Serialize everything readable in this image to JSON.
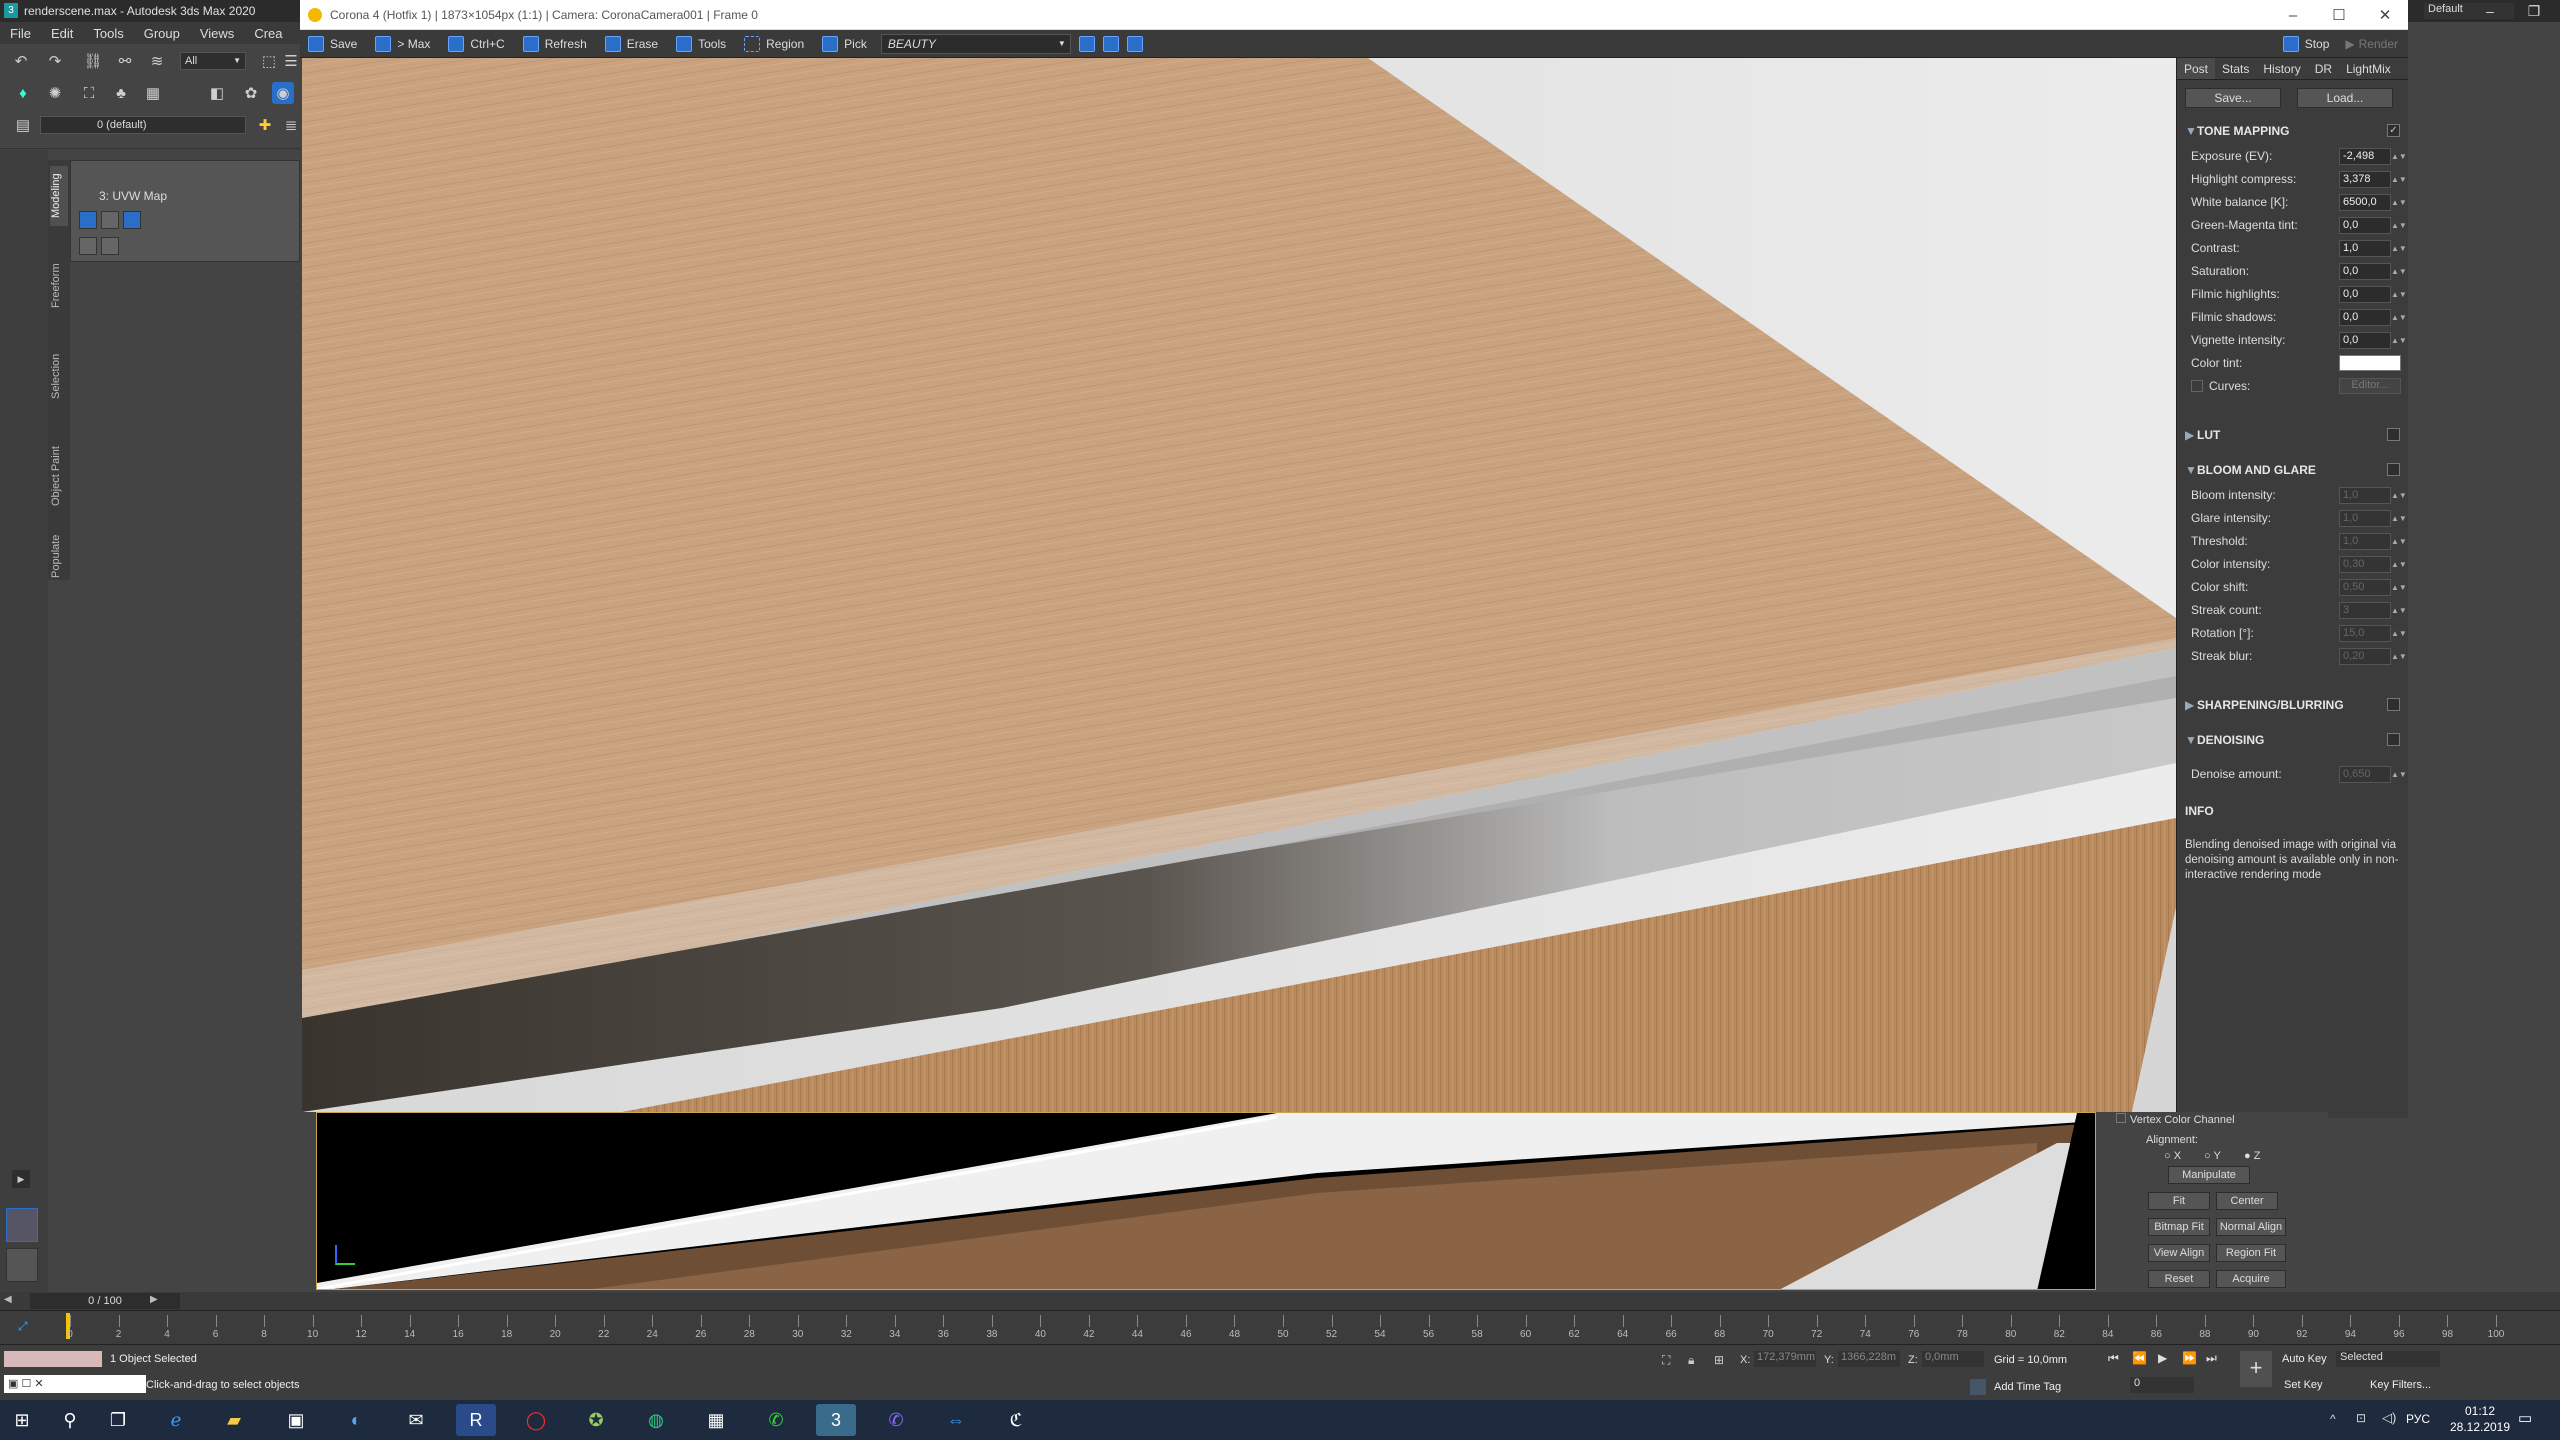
{
  "app": {
    "title": "renderscene.max - Autodesk 3ds Max 2020",
    "menu": [
      "File",
      "Edit",
      "Tools",
      "Group",
      "Views",
      "Crea"
    ],
    "workspace": "Default",
    "selection_filter": "All",
    "layer": "0 (default)"
  },
  "render_window": {
    "title": "Corona 4 (Hotfix 1) | 1873×1054px (1:1) | Camera: CoronaCamera001 | Frame 0",
    "toolbar": {
      "save": "Save",
      "to_max": "> Max",
      "ctrl_c": "Ctrl+C",
      "refresh": "Refresh",
      "erase": "Erase",
      "tools": "Tools",
      "region": "Region",
      "pick": "Pick",
      "channel": "BEAUTY",
      "stop": "Stop",
      "render": "Render"
    }
  },
  "post_panel": {
    "tabs": [
      "Post",
      "Stats",
      "History",
      "DR",
      "LightMix"
    ],
    "save_btn": "Save...",
    "load_btn": "Load...",
    "tone_mapping": {
      "title": "TONE MAPPING",
      "rows": [
        {
          "label": "Exposure (EV):",
          "value": "-2,498"
        },
        {
          "label": "Highlight compress:",
          "value": "3,378"
        },
        {
          "label": "White balance [K]:",
          "value": "6500,0"
        },
        {
          "label": "Green-Magenta tint:",
          "value": "0,0"
        },
        {
          "label": "Contrast:",
          "value": "1,0"
        },
        {
          "label": "Saturation:",
          "value": "0,0"
        },
        {
          "label": "Filmic highlights:",
          "value": "0,0"
        },
        {
          "label": "Filmic shadows:",
          "value": "0,0"
        },
        {
          "label": "Vignette intensity:",
          "value": "0,0"
        }
      ],
      "color_tint_label": "Color tint:",
      "curves_label": "Curves:",
      "curves_btn": "Editor..."
    },
    "lut": {
      "title": "LUT"
    },
    "bloom": {
      "title": "BLOOM AND GLARE",
      "rows": [
        {
          "label": "Bloom intensity:",
          "value": "1,0"
        },
        {
          "label": "Glare intensity:",
          "value": "1,0"
        },
        {
          "label": "Threshold:",
          "value": "1,0"
        },
        {
          "label": "Color intensity:",
          "value": "0,30"
        },
        {
          "label": "Color shift:",
          "value": "0,50"
        },
        {
          "label": "Streak count:",
          "value": "3"
        },
        {
          "label": "Rotation [°]:",
          "value": "15,0"
        },
        {
          "label": "Streak blur:",
          "value": "0,20"
        }
      ]
    },
    "sharpening": {
      "title": "SHARPENING/BLURRING"
    },
    "denoising": {
      "title": "DENOISING",
      "amount_label": "Denoise amount:",
      "amount_value": "0,650"
    },
    "info": {
      "title": "INFO",
      "text": "Blending denoised image with original via denoising amount is available only in non-interactive rendering mode"
    }
  },
  "modifier": {
    "name": "3: UVW Map",
    "vertex_color": "Vertex Color Channel",
    "alignment_label": "Alignment:",
    "axes": [
      "X",
      "Y",
      "Z"
    ],
    "buttons": [
      "Manipulate",
      "Fit",
      "Center",
      "Bitmap Fit",
      "Normal Align",
      "View Align",
      "Region Fit",
      "Reset",
      "Acquire"
    ]
  },
  "side_tabs": [
    "Modeling",
    "Freeform",
    "Selection",
    "Object Paint",
    "Populate"
  ],
  "timeline": {
    "frame": "0 / 100",
    "ticks": [
      "0",
      "2",
      "4",
      "6",
      "8",
      "10",
      "12",
      "14",
      "16",
      "18",
      "20",
      "22",
      "24",
      "26",
      "28",
      "30",
      "32",
      "34",
      "36",
      "38",
      "40",
      "42",
      "44",
      "46",
      "48",
      "50",
      "52",
      "54",
      "56",
      "58",
      "60",
      "62",
      "64",
      "66",
      "68",
      "70",
      "72",
      "74",
      "76",
      "78",
      "80",
      "82",
      "84",
      "86",
      "88",
      "90",
      "92",
      "94",
      "96",
      "98",
      "100"
    ]
  },
  "status": {
    "selected": "1 Object Selected",
    "hint": "Click-and-drag to select objects",
    "x_label": "X:",
    "x_value": "172,379mm",
    "y_label": "Y:",
    "y_value": "1366,228m",
    "z_label": "Z:",
    "z_value": "0,0mm",
    "grid": "Grid = 10,0mm",
    "add_time_tag": "Add Time Tag",
    "auto_key": "Auto Key",
    "set_key": "Set Key",
    "key_mode": "Selected",
    "key_filters": "Key Filters...",
    "frame_field": "0"
  },
  "taskbar": {
    "lang": "РУС",
    "time": "01:12",
    "date": "28.12.2019"
  },
  "colors": {
    "accent": "#2a6fc7",
    "wood": "#c9a27f",
    "taskbar": "#1e2a3d"
  }
}
